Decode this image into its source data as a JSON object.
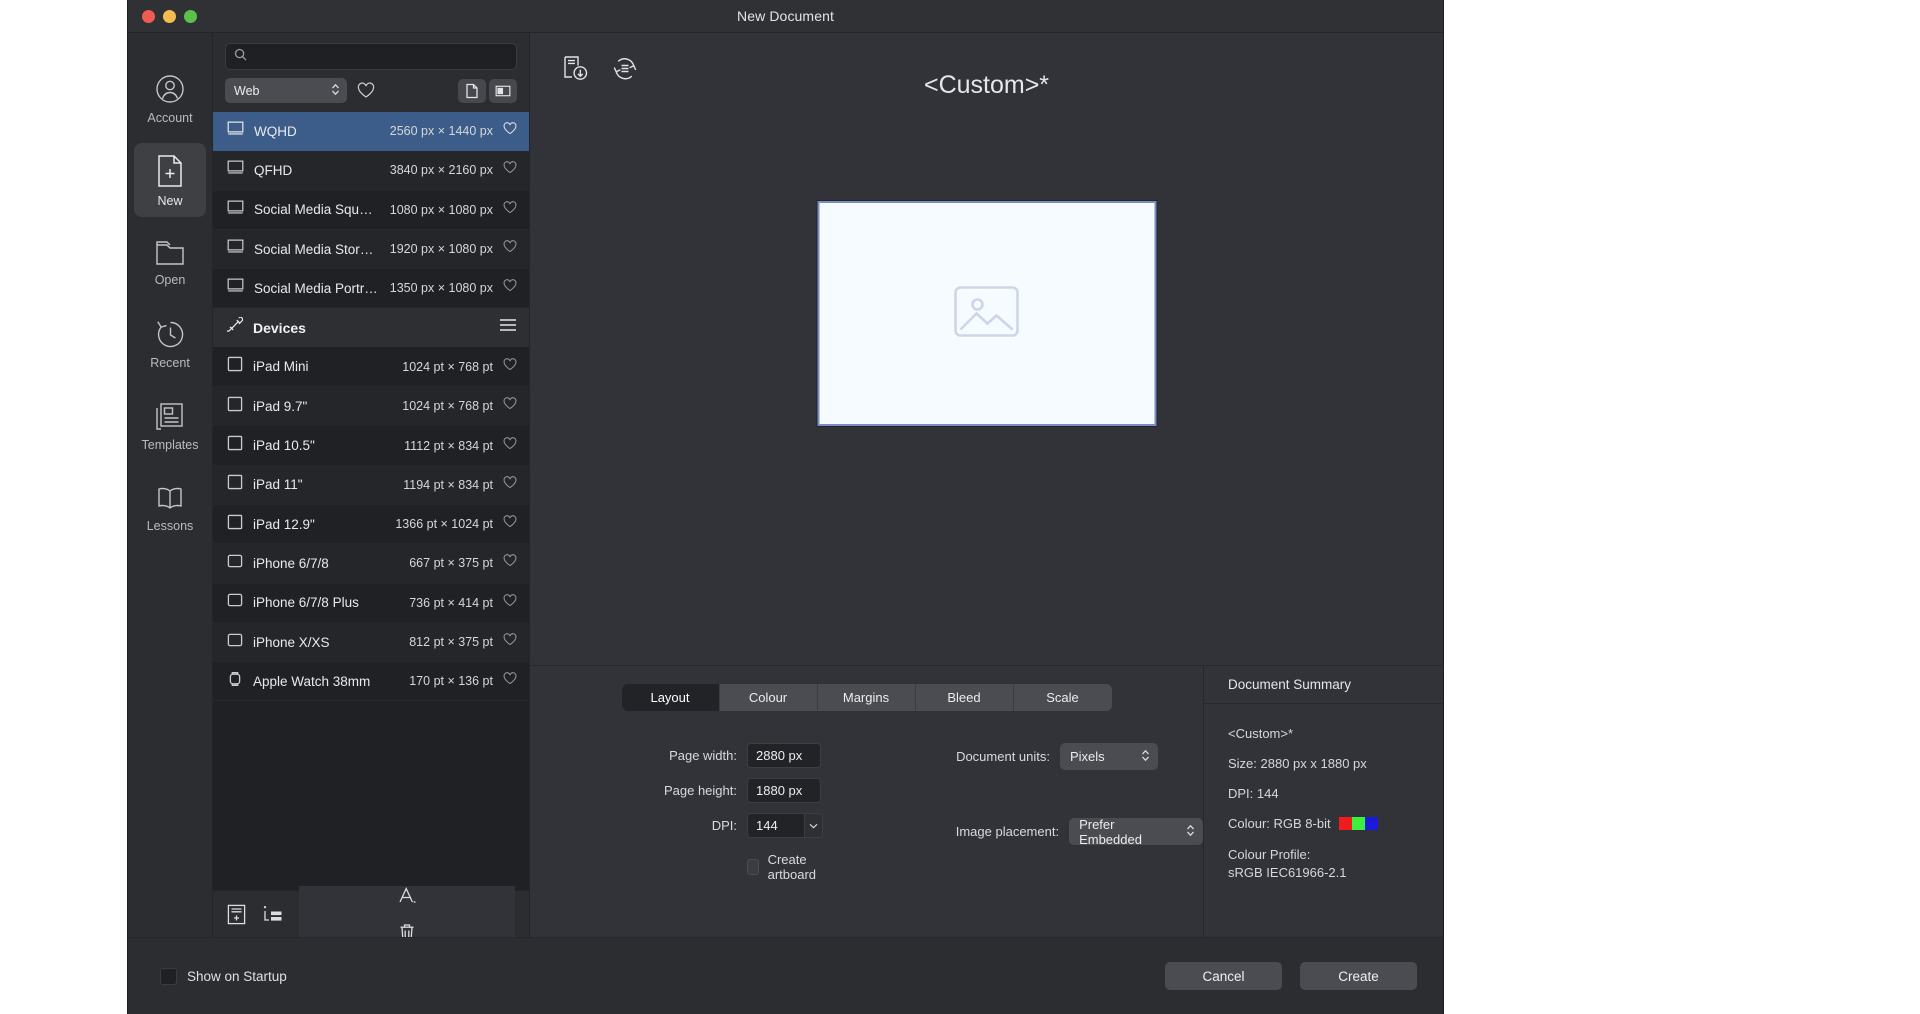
{
  "window": {
    "title": "New Document"
  },
  "rail": {
    "items": [
      {
        "label": "Account",
        "icon": "account-icon",
        "active": false
      },
      {
        "label": "New",
        "icon": "new-document-icon",
        "active": true
      },
      {
        "label": "Open",
        "icon": "open-folder-icon",
        "active": false
      },
      {
        "label": "Recent",
        "icon": "recent-clock-icon",
        "active": false
      },
      {
        "label": "Templates",
        "icon": "templates-icon",
        "active": false
      },
      {
        "label": "Lessons",
        "icon": "lessons-icon",
        "active": false
      }
    ]
  },
  "presets": {
    "search": {
      "value": "",
      "placeholder": ""
    },
    "category": {
      "value": "Web"
    },
    "favourite_icon": "heart-icon",
    "view_grid_icon": "grid-view-icon",
    "view_list_icon": "list-view-icon",
    "rows": [
      {
        "name": "WQHD",
        "dimensions": "2560 px × 1440 px",
        "icon": "display-icon",
        "selected": true
      },
      {
        "name": "QFHD",
        "dimensions": "3840 px × 2160 px",
        "icon": "display-icon",
        "selected": false
      },
      {
        "name": "Social Media Square P...",
        "dimensions": "1080 px × 1080 px",
        "icon": "display-icon",
        "selected": false
      },
      {
        "name": "Social Media Story Post",
        "dimensions": "1920 px × 1080 px",
        "icon": "display-icon",
        "selected": false
      },
      {
        "name": "Social Media Portrait P...",
        "dimensions": "1350 px × 1080 px",
        "icon": "display-icon",
        "selected": false
      }
    ],
    "group": {
      "title": "Devices",
      "icon": "devices-icon",
      "menu_icon": "hamburger-menu-icon"
    },
    "devices": [
      {
        "name": "iPad Mini",
        "dimensions": "1024 pt × 768 pt",
        "icon": "tablet-icon"
      },
      {
        "name": "iPad 9.7\"",
        "dimensions": "1024 pt × 768 pt",
        "icon": "tablet-icon"
      },
      {
        "name": "iPad 10.5\"",
        "dimensions": "1112 pt × 834 pt",
        "icon": "tablet-icon"
      },
      {
        "name": "iPad 11\"",
        "dimensions": "1194 pt × 834 pt",
        "icon": "tablet-icon"
      },
      {
        "name": "iPad 12.9\"",
        "dimensions": "1366 pt × 1024 pt",
        "icon": "tablet-icon"
      },
      {
        "name": "iPhone 6/7/8",
        "dimensions": "667 pt × 375 pt",
        "icon": "phone-icon"
      },
      {
        "name": "iPhone 6/7/8 Plus",
        "dimensions": "736 pt × 414 pt",
        "icon": "phone-icon"
      },
      {
        "name": "iPhone X/XS",
        "dimensions": "812 pt × 375 pt",
        "icon": "phone-icon"
      },
      {
        "name": "Apple Watch 38mm",
        "dimensions": "170 pt × 136 pt",
        "icon": "watch-icon"
      }
    ],
    "footer": {
      "add_preset_icon": "add-preset-icon",
      "add_category_icon": "add-category-icon",
      "rename_icon": "rename-icon",
      "delete_icon": "trash-icon"
    }
  },
  "preview": {
    "save_preset_icon": "save-preset-icon",
    "sync_icon": "sync-icon",
    "title": "<Custom>*",
    "thumbnail_icon": "image-placeholder-icon"
  },
  "settings": {
    "tabs": [
      {
        "label": "Layout",
        "active": true
      },
      {
        "label": "Colour",
        "active": false
      },
      {
        "label": "Margins",
        "active": false
      },
      {
        "label": "Bleed",
        "active": false
      },
      {
        "label": "Scale",
        "active": false
      }
    ],
    "fields": {
      "page_width_label": "Page width:",
      "page_width_value": "2880 px",
      "page_height_label": "Page height:",
      "page_height_value": "1880 px",
      "dpi_label": "DPI:",
      "dpi_value": "144",
      "create_artboard_label": "Create artboard",
      "create_artboard_checked": false,
      "document_units_label": "Document units:",
      "document_units_value": "Pixels",
      "image_placement_label": "Image placement:",
      "image_placement_value": "Prefer Embedded"
    }
  },
  "summary": {
    "heading": "Document Summary",
    "name": "<Custom>*",
    "size": "Size: 2880 px x 1880 px",
    "dpi": "DPI:  144",
    "colour": "Colour: RGB 8-bit",
    "swatches": [
      "#f01c1c",
      "#3ef03e",
      "#1a1ad8"
    ],
    "profile_label": "Colour Profile:",
    "profile_value": "sRGB IEC61966-2.1"
  },
  "footer": {
    "show_on_startup_label": "Show on Startup",
    "show_on_startup_checked": false,
    "cancel_label": "Cancel",
    "create_label": "Create"
  }
}
